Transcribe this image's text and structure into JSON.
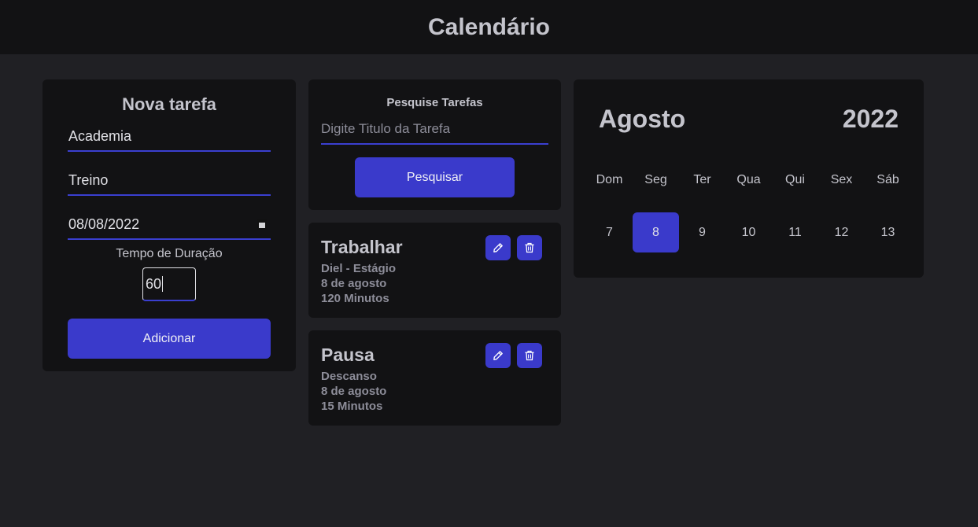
{
  "header": {
    "title": "Calendário"
  },
  "new_task": {
    "title": "Nova tarefa",
    "title_value": "Academia",
    "description_value": "Treino",
    "date_value": "08/08/2022",
    "duration_label": "Tempo de Duração",
    "duration_value": "60",
    "add_label": "Adicionar",
    "accent_color": "#3a3acb"
  },
  "search": {
    "title": "Pesquise Tarefas",
    "placeholder": "Digite Titulo da Tarefa",
    "button_label": "Pesquisar"
  },
  "tasks": [
    {
      "name": "Trabalhar",
      "description": "Diel - Estágio",
      "date": "8 de agosto",
      "duration": "120 Minutos",
      "edit_icon": "pencil-icon",
      "delete_icon": "trash-icon"
    },
    {
      "name": "Pausa",
      "description": "Descanso",
      "date": "8 de agosto",
      "duration": "15 Minutos",
      "edit_icon": "pencil-icon",
      "delete_icon": "trash-icon"
    }
  ],
  "calendar": {
    "month": "Agosto",
    "year": "2022",
    "weekdays": [
      "Dom",
      "Seg",
      "Ter",
      "Qua",
      "Qui",
      "Sex",
      "Sáb"
    ],
    "days": [
      "7",
      "8",
      "9",
      "10",
      "11",
      "12",
      "13"
    ],
    "selected_day": "8"
  }
}
